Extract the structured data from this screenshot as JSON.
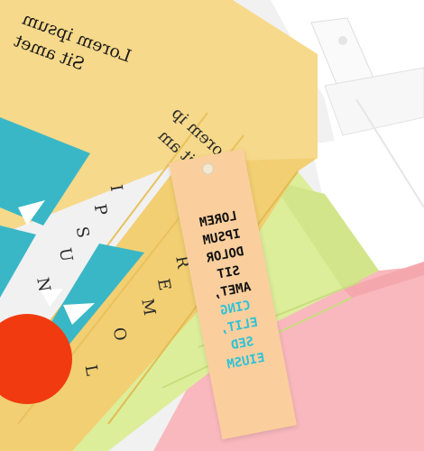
{
  "cover": {
    "title_line1": "Lorem ipsum",
    "title_line2": "Sit amet"
  },
  "spine": {
    "title_line1": "Lorem ip",
    "title_line2": "Sit am",
    "letters": [
      "N",
      "U",
      "S",
      "P",
      "I",
      "M",
      "E",
      "R",
      "O",
      "L"
    ]
  },
  "bookmark": {
    "lines_dark": [
      "LOREM",
      "IPSUM",
      "DOLOR",
      "SIT",
      "AMET,"
    ],
    "lines_cyan": [
      "CING",
      "ELIT,",
      "SED",
      "EIUSM"
    ]
  },
  "colors": {
    "book_yellow": "#f6d98a",
    "spine_yellow": "#f2cf72",
    "cover_teal": "#3ab7c6",
    "book_green": "#dcee9a",
    "book_pink": "#f9b8bd",
    "bookmark_peach": "#fbcf9d",
    "accent_red": "#f23a10",
    "text_cyan": "#2ec2d8"
  }
}
